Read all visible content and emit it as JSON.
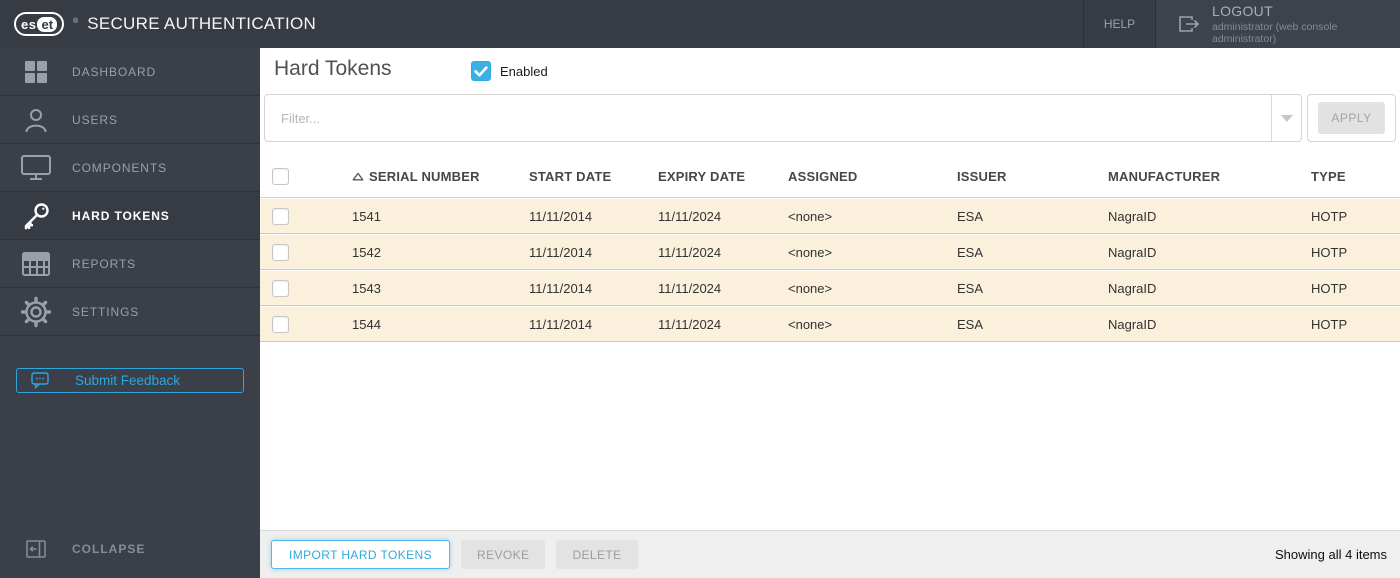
{
  "colors": {
    "accent_blue": "#2fa9de",
    "topbar_bg": "#363b44",
    "sidebar_bg": "#3a3f48",
    "row_bg": "#fbf0dc",
    "checked_checkbox": "#3bb0e7",
    "disabled_button_bg": "#e3e3e3"
  },
  "topbar": {
    "logo": {
      "es": "es",
      "et": "et",
      "reg": "®"
    },
    "product": "SECURE AUTHENTICATION",
    "help": "HELP",
    "logout": "LOGOUT",
    "logout_user": "administrator (web console administrator)"
  },
  "sidebar": {
    "items": [
      {
        "label": "DASHBOARD",
        "icon": "dashboard-icon",
        "active": false
      },
      {
        "label": "USERS",
        "icon": "users-icon",
        "active": false
      },
      {
        "label": "COMPONENTS",
        "icon": "components-icon",
        "active": false
      },
      {
        "label": "HARD TOKENS",
        "icon": "key-icon",
        "active": true
      },
      {
        "label": "REPORTS",
        "icon": "reports-icon",
        "active": false
      },
      {
        "label": "SETTINGS",
        "icon": "settings-icon",
        "active": false
      }
    ],
    "feedback": "Submit Feedback",
    "collapse": "COLLAPSE"
  },
  "main": {
    "title": "Hard Tokens",
    "enabled": {
      "label": "Enabled",
      "checked": true
    },
    "filter": {
      "placeholder": "Filter...",
      "apply": "APPLY"
    },
    "table": {
      "headers": {
        "serial": "SERIAL NUMBER",
        "start": "START DATE",
        "expiry": "EXPIRY DATE",
        "assigned": "ASSIGNED",
        "issuer": "ISSUER",
        "manufacturer": "MANUFACTURER",
        "type": "TYPE"
      },
      "sort": {
        "column": "SERIAL NUMBER",
        "direction": "ascending"
      },
      "rows": [
        {
          "serial": "1541",
          "start": "11/11/2014",
          "expiry": "11/11/2024",
          "assigned": "<none>",
          "issuer": "ESA",
          "manufacturer": "NagraID",
          "type": "HOTP"
        },
        {
          "serial": "1542",
          "start": "11/11/2014",
          "expiry": "11/11/2024",
          "assigned": "<none>",
          "issuer": "ESA",
          "manufacturer": "NagraID",
          "type": "HOTP"
        },
        {
          "serial": "1543",
          "start": "11/11/2014",
          "expiry": "11/11/2024",
          "assigned": "<none>",
          "issuer": "ESA",
          "manufacturer": "NagraID",
          "type": "HOTP"
        },
        {
          "serial": "1544",
          "start": "11/11/2014",
          "expiry": "11/11/2024",
          "assigned": "<none>",
          "issuer": "ESA",
          "manufacturer": "NagraID",
          "type": "HOTP"
        }
      ]
    },
    "footer": {
      "import": "IMPORT HARD TOKENS",
      "revoke": "REVOKE",
      "delete": "DELETE",
      "status": "Showing all 4 items"
    }
  }
}
